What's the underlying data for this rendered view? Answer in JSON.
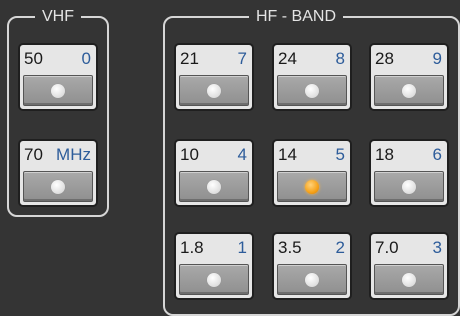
{
  "vhf": {
    "title": "VHF",
    "buttons": [
      {
        "label": "50",
        "num": "0"
      },
      {
        "label": "70",
        "num": "MHz"
      }
    ]
  },
  "hf": {
    "title": "HF - BAND",
    "buttons": [
      {
        "label": "21",
        "num": "7"
      },
      {
        "label": "24",
        "num": "8"
      },
      {
        "label": "28",
        "num": "9"
      },
      {
        "label": "10",
        "num": "4"
      },
      {
        "label": "14",
        "num": "5"
      },
      {
        "label": "18",
        "num": "6"
      },
      {
        "label": "1.8",
        "num": "1"
      },
      {
        "label": "3.5",
        "num": "2"
      },
      {
        "label": "7.0",
        "num": "3"
      }
    ]
  },
  "active_band": "14",
  "colors": {
    "background": "#343434",
    "frame": "#d6d6d6",
    "digit_blue": "#2d5c9a",
    "led_active": "#f6a21a",
    "led_inactive": "#e6e6e6"
  }
}
